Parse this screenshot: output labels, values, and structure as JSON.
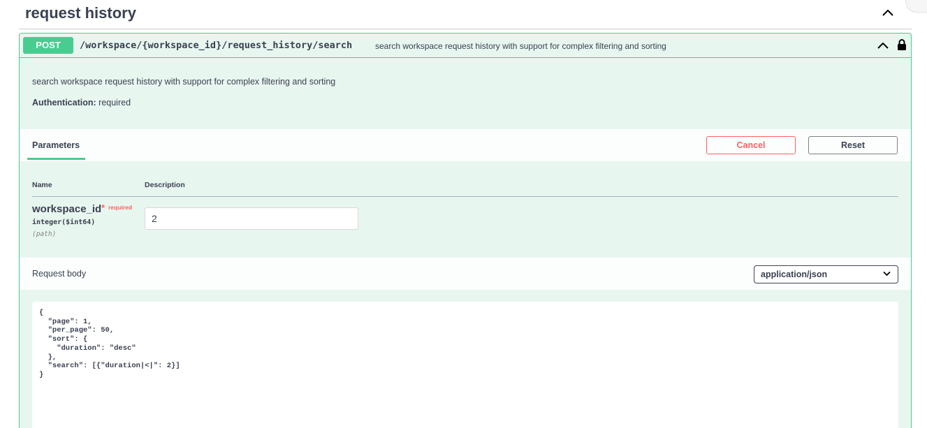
{
  "section": {
    "title": "request history",
    "collapse_icon": "chevron-up-icon"
  },
  "operation": {
    "method": "POST",
    "path": "/workspace/{workspace_id}/request_history/search",
    "summary": "search workspace request history with support for complex filtering and sorting",
    "description": "search workspace request history with support for complex filtering and sorting",
    "auth_label": "Authentication:",
    "auth_value": "required",
    "accent_color": "#49cc90",
    "icons": [
      "chevron-up-icon",
      "lock-icon"
    ]
  },
  "parameters": {
    "tab_label": "Parameters",
    "cancel_label": "Cancel",
    "reset_label": "Reset",
    "columns": [
      "Name",
      "Description"
    ],
    "items": [
      {
        "name": "workspace_id",
        "required_star": "*",
        "required_label": "required",
        "type": "integer($int64)",
        "in": "(path)",
        "value": "2"
      }
    ]
  },
  "request_body": {
    "label": "Request body",
    "content_type": "application/json",
    "code": "{\n  \"page\": 1,\n  \"per_page\": 50,\n  \"sort\": {\n    \"duration\": \"desc\"\n  },\n  \"search\": [{\"duration|<|\": 2}]\n}"
  }
}
